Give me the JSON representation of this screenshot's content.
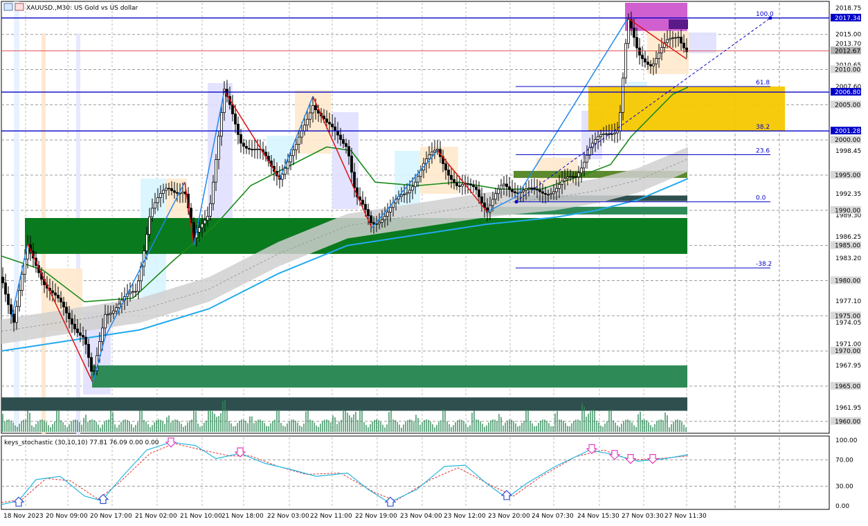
{
  "window": {
    "symbol_line": "XAUUSD.,M30: US Gold vs US dollar",
    "top_left_mark": "-"
  },
  "indicator": {
    "label": "keys_stochastic (30,10,10) 77.81 76.09 0.00 0.00",
    "levels": [
      "100.00",
      "70.00",
      "30.00",
      "0.00"
    ],
    "k_color": "#22b8e0",
    "d_color": "#e03030"
  },
  "colors": {
    "price_line": "#0000c8",
    "zigzag_up": "#2288ee",
    "zigzag_down": "#e01010",
    "ma_green": "#1a8a1a",
    "ma_blue": "#22aaee",
    "zone_dark_green": "#0a7a1e",
    "zone_mid_green": "#2e8b57",
    "zone_slate": "#2f4f4f",
    "fib_gold": "#f5c800",
    "magenta": "#d060d0"
  },
  "chart_data": {
    "type": "candlestick",
    "title": "XAUUSD.,M30: US Gold vs US dollar",
    "ylim": [
      1958.5,
      2019.5
    ],
    "y_tick_labels": [
      "2018.75",
      "2015.00",
      "2013.70",
      "2010.65",
      "2007.60",
      "2005.00",
      "2000.00",
      "1998.45",
      "1995.00",
      "1992.35",
      "1990.00",
      "1989.30",
      "1986.25",
      "1985.00",
      "1983.20",
      "1980.00",
      "1977.10",
      "1975.00",
      "1974.05",
      "1971.00",
      "1970.00",
      "1967.95",
      "1965.00",
      "1961.95",
      "1960.00"
    ],
    "highlighted_price_labels": [
      {
        "text": "2017.34",
        "value": 2017.34,
        "kind": "line"
      },
      {
        "text": "2012.67",
        "value": 2012.67,
        "kind": "current"
      },
      {
        "text": "2010.00",
        "value": 2010.0,
        "kind": "level"
      },
      {
        "text": "2006.80",
        "value": 2006.8,
        "kind": "line"
      },
      {
        "text": "2005.00",
        "value": 2005.0,
        "kind": "level"
      },
      {
        "text": "2001.28",
        "value": 2001.28,
        "kind": "line"
      },
      {
        "text": "2000.00",
        "value": 2000.0,
        "kind": "level"
      },
      {
        "text": "1995.00",
        "value": 1995.0,
        "kind": "level"
      },
      {
        "text": "1990.00",
        "value": 1990.0,
        "kind": "level"
      },
      {
        "text": "1985.00",
        "value": 1985.0,
        "kind": "level"
      },
      {
        "text": "1980.00",
        "value": 1980.0,
        "kind": "level"
      },
      {
        "text": "1975.00",
        "value": 1975.0,
        "kind": "level"
      },
      {
        "text": "1970.00",
        "value": 1970.0,
        "kind": "level"
      },
      {
        "text": "1965.00",
        "value": 1965.0,
        "kind": "level"
      },
      {
        "text": "1960.00",
        "value": 1960.0,
        "kind": "level"
      }
    ],
    "x_tick_labels": [
      "18 Nov 2023",
      "20 Nov 09:00",
      "20 Nov 17:00",
      "21 Nov 02:00",
      "21 Nov 10:00",
      "21 Nov 18:00",
      "22 Nov 03:00",
      "22 Nov 11:00",
      "22 Nov 19:00",
      "23 Nov 04:00",
      "23 Nov 12:00",
      "23 Nov 20:00",
      "24 Nov 07:30",
      "24 Nov 15:30",
      "27 Nov 03:30",
      "27 Nov 11:30"
    ],
    "horizontal_lines": [
      2017.34,
      2006.8,
      2001.28
    ],
    "current_price": 2012.67,
    "fibonacci": {
      "levels": [
        {
          "label": "100.0",
          "value": 2017.34
        },
        {
          "label": "61.8",
          "value": 2007.6
        },
        {
          "label": "38.2",
          "value": 2001.28
        },
        {
          "label": "23.6",
          "value": 1997.9
        },
        {
          "label": "0.0",
          "value": 1991.2
        },
        {
          "label": "-38.2",
          "value": 1981.8
        }
      ]
    },
    "zones": [
      {
        "from": 1983.8,
        "to": 1988.9,
        "color": "dark-green"
      },
      {
        "from": 1964.8,
        "to": 1967.95,
        "color": "sea-green"
      },
      {
        "from": 1961.5,
        "to": 1963.4,
        "color": "slate"
      },
      {
        "from": 1994.6,
        "to": 1995.6,
        "color": "olive"
      },
      {
        "from": 1989.4,
        "to": 1990.5,
        "color": "sea-green"
      },
      {
        "from": 1991.3,
        "to": 1992.1,
        "color": "slate"
      },
      {
        "from": 2001.28,
        "to": 2007.6,
        "color": "gold"
      },
      {
        "from": 2015.5,
        "to": 2019.5,
        "color": "magenta"
      }
    ],
    "close_path": [
      {
        "x": 0,
        "y": 1980.5
      },
      {
        "x": 18,
        "y": 1974.5
      },
      {
        "x": 38,
        "y": 1984.5
      },
      {
        "x": 62,
        "y": 1980.0
      },
      {
        "x": 95,
        "y": 1975.0
      },
      {
        "x": 120,
        "y": 1972.0
      },
      {
        "x": 132,
        "y": 1965.5
      },
      {
        "x": 150,
        "y": 1975.5
      },
      {
        "x": 175,
        "y": 1977.0
      },
      {
        "x": 195,
        "y": 1978.5
      },
      {
        "x": 215,
        "y": 1990.0
      },
      {
        "x": 240,
        "y": 1993.0
      },
      {
        "x": 265,
        "y": 1993.0
      },
      {
        "x": 278,
        "y": 1985.5
      },
      {
        "x": 300,
        "y": 1990.0
      },
      {
        "x": 322,
        "y": 2006.8
      },
      {
        "x": 345,
        "y": 2000.0
      },
      {
        "x": 375,
        "y": 1998.0
      },
      {
        "x": 402,
        "y": 1995.0
      },
      {
        "x": 425,
        "y": 1998.5
      },
      {
        "x": 450,
        "y": 2005.5
      },
      {
        "x": 470,
        "y": 2002.0
      },
      {
        "x": 500,
        "y": 1999.5
      },
      {
        "x": 512,
        "y": 1992.0
      },
      {
        "x": 535,
        "y": 1988.0
      },
      {
        "x": 560,
        "y": 1990.0
      },
      {
        "x": 585,
        "y": 1992.5
      },
      {
        "x": 610,
        "y": 1996.5
      },
      {
        "x": 630,
        "y": 1998.5
      },
      {
        "x": 660,
        "y": 1993.0
      },
      {
        "x": 685,
        "y": 1993.5
      },
      {
        "x": 702,
        "y": 1990.0
      },
      {
        "x": 725,
        "y": 1993.5
      },
      {
        "x": 745,
        "y": 1993.0
      },
      {
        "x": 770,
        "y": 1992.5
      },
      {
        "x": 800,
        "y": 1993.0
      },
      {
        "x": 830,
        "y": 1995.0
      },
      {
        "x": 850,
        "y": 1999.0
      },
      {
        "x": 870,
        "y": 2000.5
      },
      {
        "x": 892,
        "y": 2002.0
      },
      {
        "x": 905,
        "y": 2017.0
      },
      {
        "x": 920,
        "y": 2012.0
      },
      {
        "x": 940,
        "y": 2011.0
      },
      {
        "x": 960,
        "y": 2013.5
      },
      {
        "x": 978,
        "y": 2015.0
      },
      {
        "x": 992,
        "y": 2012.67
      }
    ],
    "zigzag": [
      {
        "x": 14,
        "y": 1974.5
      },
      {
        "x": 38,
        "y": 1985.2
      },
      {
        "x": 132,
        "y": 1965.5
      },
      {
        "x": 150,
        "y": 1972.0
      },
      {
        "x": 265,
        "y": 1994.0
      },
      {
        "x": 278,
        "y": 1985.0
      },
      {
        "x": 322,
        "y": 2007.0
      },
      {
        "x": 402,
        "y": 1994.5
      },
      {
        "x": 450,
        "y": 2006.2
      },
      {
        "x": 535,
        "y": 1987.5
      },
      {
        "x": 630,
        "y": 1998.5
      },
      {
        "x": 702,
        "y": 1989.8
      },
      {
        "x": 745,
        "y": 1992.0
      },
      {
        "x": 905,
        "y": 2017.3
      },
      {
        "x": 990,
        "y": 2011.5
      }
    ],
    "ma_green": [
      {
        "x": 0,
        "y": 1983.5
      },
      {
        "x": 60,
        "y": 1981.5
      },
      {
        "x": 120,
        "y": 1977.0
      },
      {
        "x": 190,
        "y": 1977.5
      },
      {
        "x": 250,
        "y": 1983.0
      },
      {
        "x": 310,
        "y": 1988.0
      },
      {
        "x": 360,
        "y": 1993.5
      },
      {
        "x": 420,
        "y": 1996.5
      },
      {
        "x": 470,
        "y": 1999.0
      },
      {
        "x": 505,
        "y": 1998.5
      },
      {
        "x": 540,
        "y": 1994.0
      },
      {
        "x": 600,
        "y": 1993.5
      },
      {
        "x": 660,
        "y": 1994.0
      },
      {
        "x": 720,
        "y": 1993.0
      },
      {
        "x": 780,
        "y": 1993.0
      },
      {
        "x": 840,
        "y": 1995.0
      },
      {
        "x": 880,
        "y": 1996.5
      },
      {
        "x": 910,
        "y": 2000.5
      },
      {
        "x": 940,
        "y": 2003.5
      },
      {
        "x": 970,
        "y": 2006.5
      },
      {
        "x": 992,
        "y": 2007.5
      }
    ],
    "ma_blue": [
      {
        "x": 0,
        "y": 1970.0
      },
      {
        "x": 100,
        "y": 1971.5
      },
      {
        "x": 200,
        "y": 1973.0
      },
      {
        "x": 300,
        "y": 1976.0
      },
      {
        "x": 400,
        "y": 1981.0
      },
      {
        "x": 500,
        "y": 1985.0
      },
      {
        "x": 600,
        "y": 1986.5
      },
      {
        "x": 700,
        "y": 1988.0
      },
      {
        "x": 800,
        "y": 1989.0
      },
      {
        "x": 860,
        "y": 1990.0
      },
      {
        "x": 920,
        "y": 1991.5
      },
      {
        "x": 992,
        "y": 1994.5
      }
    ],
    "stochastic_k": [
      {
        "x": 0,
        "y": 2
      },
      {
        "x": 25,
        "y": 8
      },
      {
        "x": 50,
        "y": 40
      },
      {
        "x": 85,
        "y": 45
      },
      {
        "x": 120,
        "y": 15
      },
      {
        "x": 145,
        "y": 8
      },
      {
        "x": 175,
        "y": 45
      },
      {
        "x": 210,
        "y": 85
      },
      {
        "x": 245,
        "y": 97
      },
      {
        "x": 280,
        "y": 92
      },
      {
        "x": 310,
        "y": 72
      },
      {
        "x": 345,
        "y": 80
      },
      {
        "x": 380,
        "y": 65
      },
      {
        "x": 420,
        "y": 55
      },
      {
        "x": 455,
        "y": 45
      },
      {
        "x": 500,
        "y": 50
      },
      {
        "x": 530,
        "y": 25
      },
      {
        "x": 560,
        "y": 5
      },
      {
        "x": 600,
        "y": 25
      },
      {
        "x": 640,
        "y": 60
      },
      {
        "x": 670,
        "y": 62
      },
      {
        "x": 700,
        "y": 35
      },
      {
        "x": 730,
        "y": 12
      },
      {
        "x": 760,
        "y": 35
      },
      {
        "x": 800,
        "y": 60
      },
      {
        "x": 850,
        "y": 85
      },
      {
        "x": 885,
        "y": 78
      },
      {
        "x": 920,
        "y": 68
      },
      {
        "x": 960,
        "y": 72
      },
      {
        "x": 992,
        "y": 78
      }
    ],
    "stochastic_d": [
      {
        "x": 0,
        "y": 5
      },
      {
        "x": 30,
        "y": 10
      },
      {
        "x": 65,
        "y": 42
      },
      {
        "x": 100,
        "y": 38
      },
      {
        "x": 140,
        "y": 10
      },
      {
        "x": 170,
        "y": 35
      },
      {
        "x": 215,
        "y": 80
      },
      {
        "x": 250,
        "y": 95
      },
      {
        "x": 290,
        "y": 85
      },
      {
        "x": 330,
        "y": 76
      },
      {
        "x": 360,
        "y": 76
      },
      {
        "x": 400,
        "y": 60
      },
      {
        "x": 440,
        "y": 48
      },
      {
        "x": 490,
        "y": 50
      },
      {
        "x": 540,
        "y": 20
      },
      {
        "x": 570,
        "y": 8
      },
      {
        "x": 620,
        "y": 40
      },
      {
        "x": 660,
        "y": 58
      },
      {
        "x": 710,
        "y": 30
      },
      {
        "x": 740,
        "y": 15
      },
      {
        "x": 780,
        "y": 45
      },
      {
        "x": 830,
        "y": 75
      },
      {
        "x": 870,
        "y": 85
      },
      {
        "x": 910,
        "y": 70
      },
      {
        "x": 950,
        "y": 72
      },
      {
        "x": 992,
        "y": 76
      }
    ],
    "stochastic_arrows_down": [
      {
        "x": 245,
        "y": 97
      },
      {
        "x": 345,
        "y": 82
      },
      {
        "x": 853,
        "y": 87
      },
      {
        "x": 886,
        "y": 78
      },
      {
        "x": 909,
        "y": 72
      },
      {
        "x": 941,
        "y": 72
      }
    ],
    "stochastic_arrows_up": [
      {
        "x": 25,
        "y": 6
      },
      {
        "x": 147,
        "y": 10
      },
      {
        "x": 562,
        "y": 6
      },
      {
        "x": 730,
        "y": 16
      }
    ]
  }
}
